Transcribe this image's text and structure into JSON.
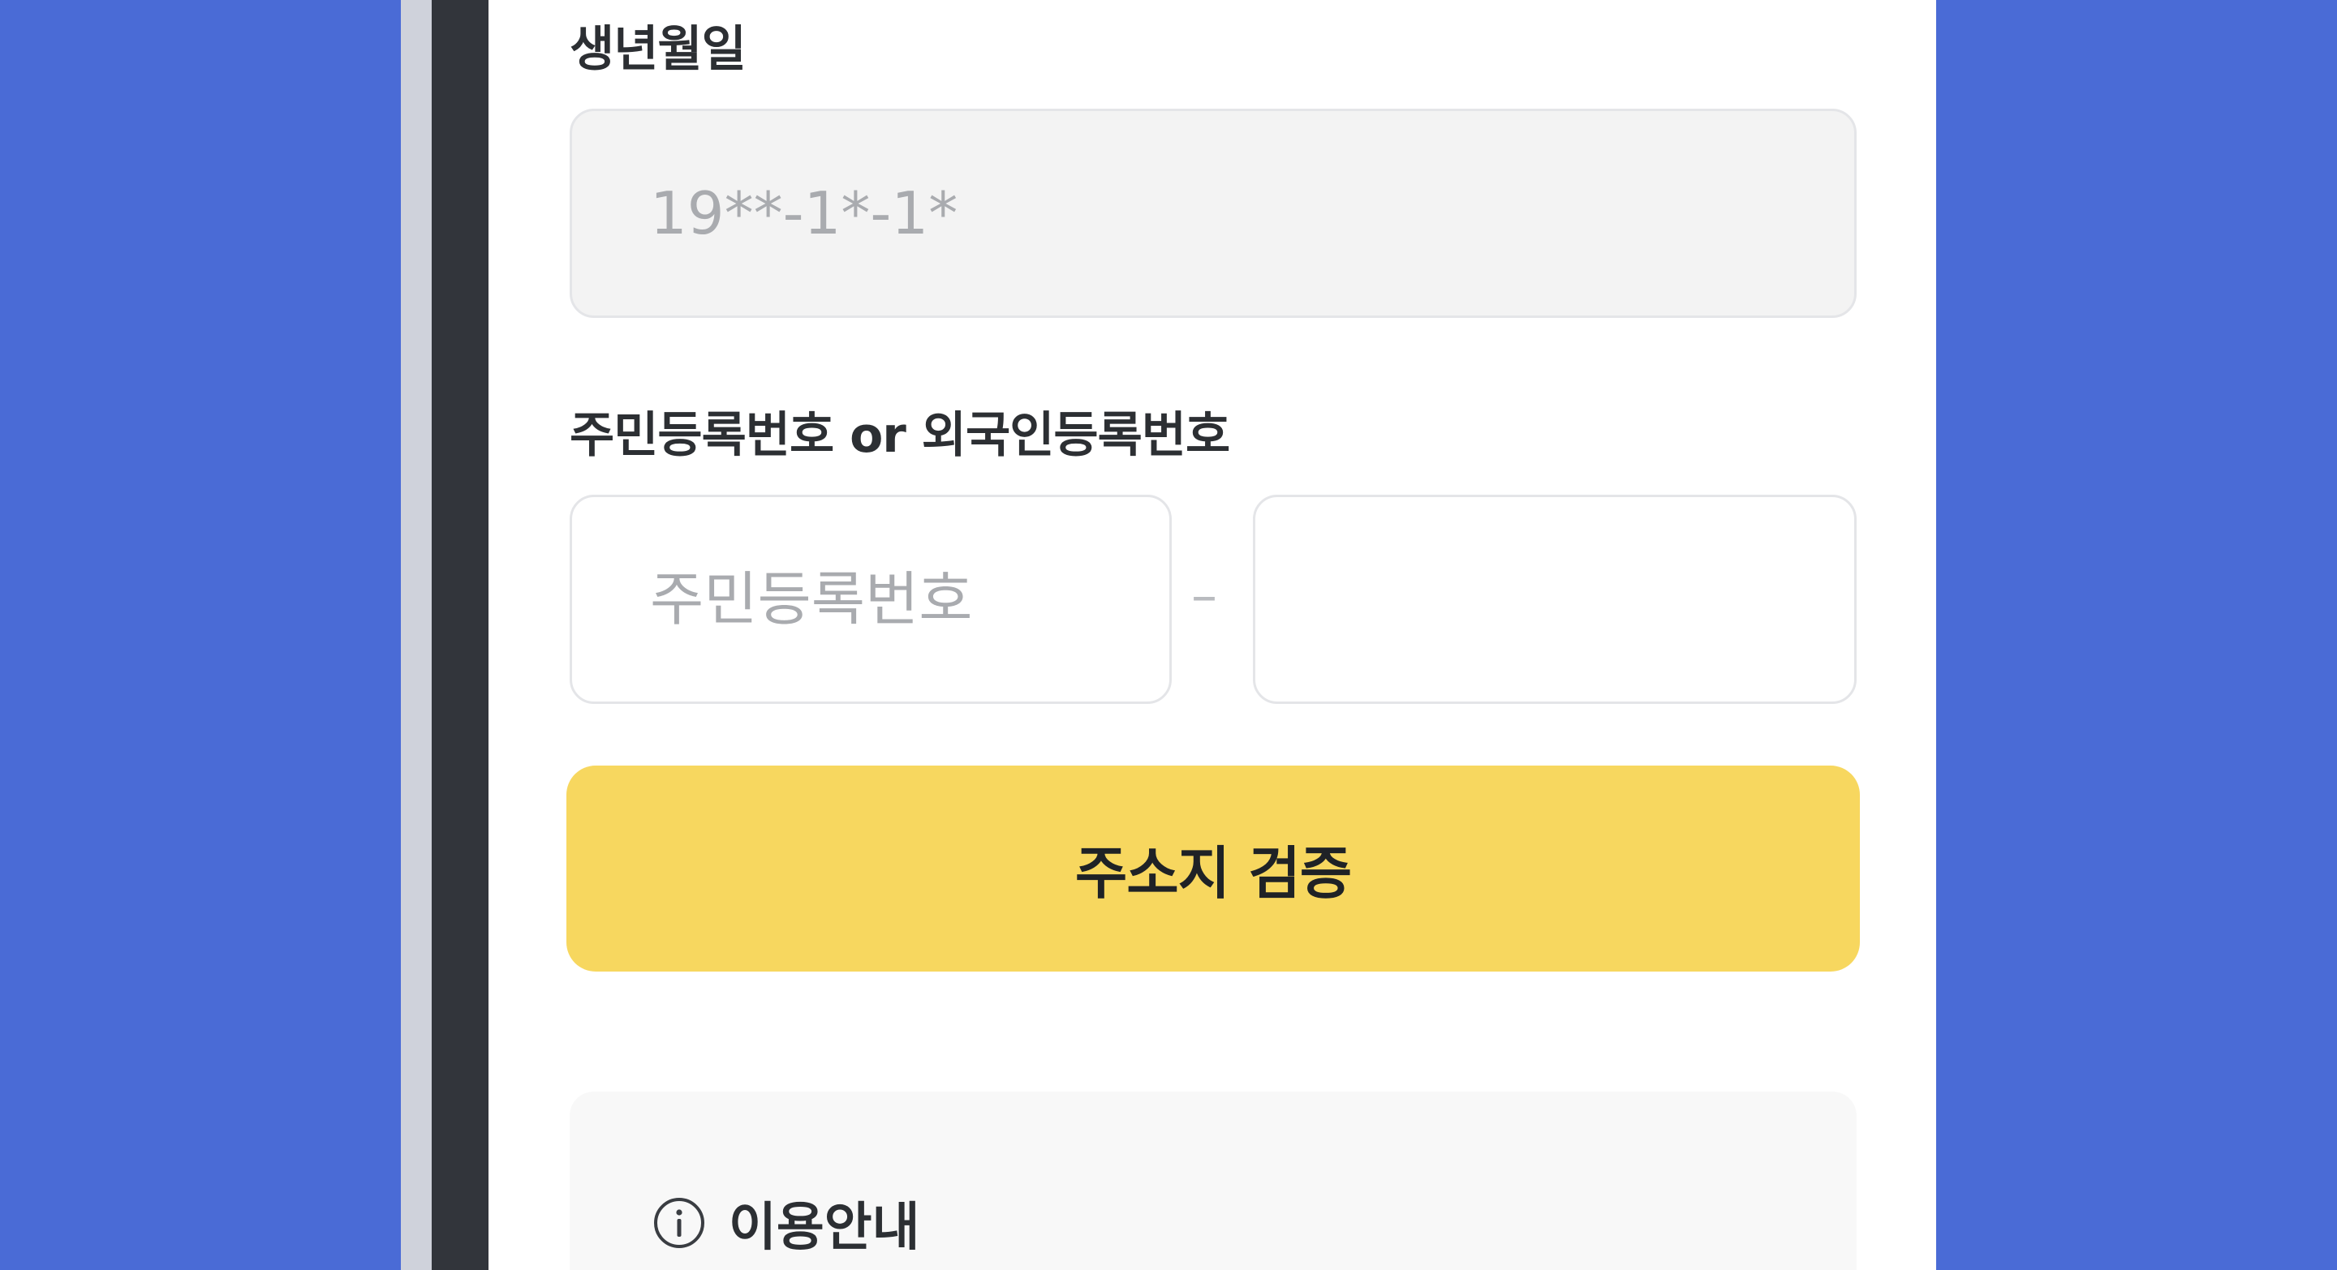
{
  "form": {
    "birth_label": "생년월일",
    "birth_value": "19**-1*-1*",
    "id_label": "주민등록번호 or 외국인등록번호",
    "id_front_placeholder": "주민등록번호",
    "id_back_placeholder": "",
    "separator": "–",
    "verify_button_label": "주소지 검증"
  },
  "info": {
    "title": "이용안내",
    "icon": "info-circle-icon"
  },
  "colors": {
    "background": "#4a6bd6",
    "button": "#f7d75f",
    "bezel": "#32353b"
  }
}
